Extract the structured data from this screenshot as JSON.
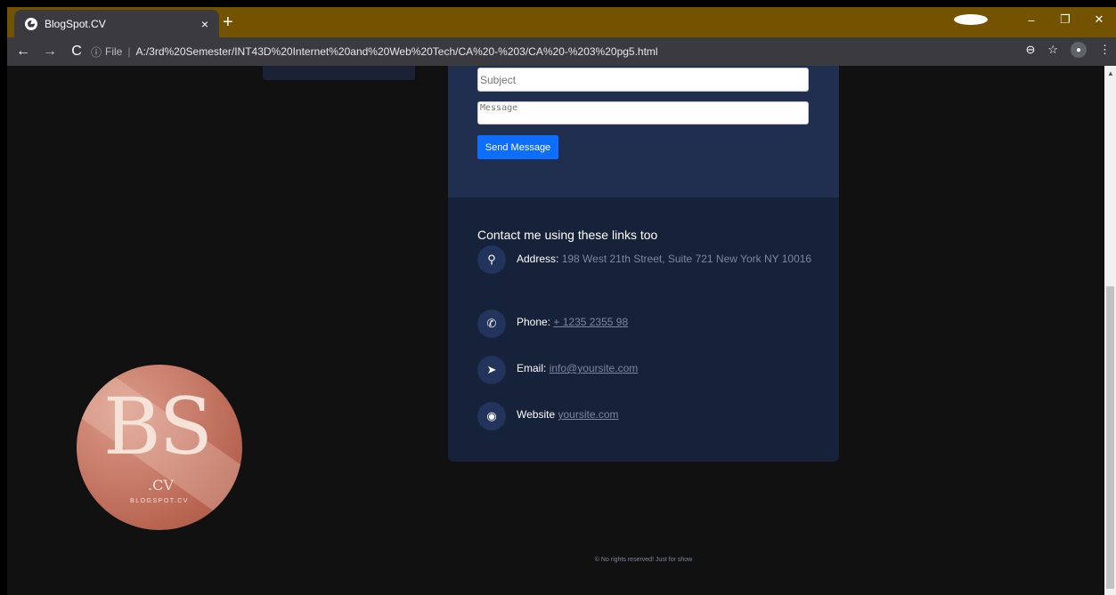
{
  "browser": {
    "tab_title": "BlogSpot.CV",
    "tab_close": "×",
    "new_tab": "+",
    "window": {
      "minimize": "–",
      "restore": "❐",
      "close": "✕"
    },
    "nav": {
      "back": "←",
      "forward": "→",
      "reload": "C"
    },
    "address": {
      "info": "ⓘ",
      "file_label": "File",
      "separator": "|",
      "url": "A:/3rd%20Semester/INT43D%20Internet%20and%20Web%20Tech/CA%20-%203/CA%20-%203%20pg5.html"
    },
    "toolbar_icons": {
      "zoom": "⊖",
      "star": "☆",
      "menu": "⋮"
    }
  },
  "form": {
    "subject_placeholder": "Subject",
    "message_placeholder": "Message",
    "send_label": "Send Message"
  },
  "contact": {
    "title": "Contact me using these links too",
    "address_label": "Address:",
    "address_value": "198 West 21th Street, Suite 721 New York NY 10016",
    "phone_label": "Phone:",
    "phone_value": "+ 1235 2355 98",
    "email_label": "Email:",
    "email_value": "info@yoursite.com",
    "website_label": "Website",
    "website_value": "yoursite.com"
  },
  "logo": {
    "monogram": "BS",
    "suffix": ".CV",
    "tagline": "BLOGSPOT.CV"
  },
  "footer": {
    "text": "© No rights reserved! Just for show"
  },
  "colors": {
    "accent": "#0d6efd",
    "form_bg": "#202e4f",
    "contact_bg": "#16213a",
    "page_bg": "#111111",
    "chrome": "#735200"
  }
}
